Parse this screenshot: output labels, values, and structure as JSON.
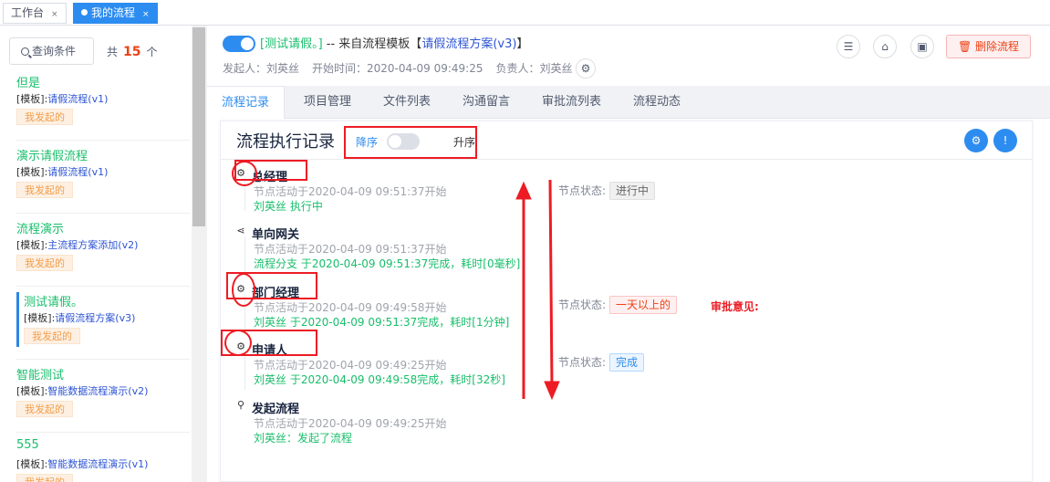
{
  "top_tabs": [
    {
      "label": "工作台",
      "close": "×",
      "active": false
    },
    {
      "label": "我的流程",
      "close": "×",
      "active": true
    }
  ],
  "left": {
    "query_button": "查询条件",
    "count_prefix": "共",
    "count": "15",
    "count_suffix": "个",
    "items": [
      {
        "title": "但是",
        "tmpl_prefix": "[模板]:",
        "tmpl": "请假流程(v1)",
        "badge": "我发起的"
      },
      {
        "title": "演示请假流程",
        "tmpl_prefix": "[模板]:",
        "tmpl": "请假流程(v1)",
        "badge": "我发起的"
      },
      {
        "title": "流程演示",
        "tmpl_prefix": "[模板]:",
        "tmpl": "主流程方案添加(v2)",
        "badge": "我发起的"
      },
      {
        "title": "测试请假。",
        "tmpl_prefix": "[模板]:",
        "tmpl": "请假流程方案(v3)",
        "badge": "我发起的"
      },
      {
        "title": "智能测试",
        "tmpl_prefix": "[模板]:",
        "tmpl": "智能数据流程演示(v2)",
        "badge": "我发起的"
      },
      {
        "title": "555",
        "tmpl_prefix": "[模板]:",
        "tmpl": "智能数据流程演示(v1)",
        "badge": "我发起的"
      }
    ]
  },
  "header": {
    "flow_name": "[测试请假。]",
    "from_text": " -- 来自流程模板【",
    "template_name": "请假流程方案(v3)",
    "close_bracket": "】",
    "initiator": "发起人：刘英丝",
    "start_time": "开始时间：2020-04-09 09:49:25",
    "owner": "负责人：刘英丝",
    "delete_button": "删除流程"
  },
  "tabs": [
    "流程记录",
    "项目管理",
    "文件列表",
    "沟通留言",
    "审批流列表",
    "流程动态"
  ],
  "record": {
    "title": "流程执行记录",
    "sort_desc": "降序",
    "sort_asc": "升序",
    "nodes": [
      {
        "name": "总经理",
        "start": "节点活动于2020-04-09 09:51:37开始",
        "detail": "刘英丝 执行中",
        "status_label": "节点状态:",
        "status": "进行中",
        "status_type": "gray"
      },
      {
        "name": "单向网关",
        "start": "节点活动于2020-04-09 09:51:37开始",
        "detail": "流程分支 于2020-04-09 09:51:37完成，耗时[0毫秒]"
      },
      {
        "name": "部门经理",
        "start": "节点活动于2020-04-09 09:49:58开始",
        "detail": "刘英丝 于2020-04-09 09:51:37完成，耗时[1分钟]",
        "status_label": "节点状态:",
        "status": "一天以上的",
        "status_type": "red",
        "opinion": "审批意见:"
      },
      {
        "name": "申请人",
        "start": "节点活动于2020-04-09 09:49:25开始",
        "detail": "刘英丝 于2020-04-09 09:49:58完成，耗时[32秒]",
        "status_label": "节点状态:",
        "status": "完成",
        "status_type": "blue"
      },
      {
        "name": "发起流程",
        "start": "节点活动于2020-04-09 09:49:25开始",
        "detail": "刘英丝：发起了流程"
      }
    ]
  },
  "colors": {
    "accent": "#2d8cf0",
    "green": "#19be6b",
    "annotation": "#ed1c24"
  }
}
